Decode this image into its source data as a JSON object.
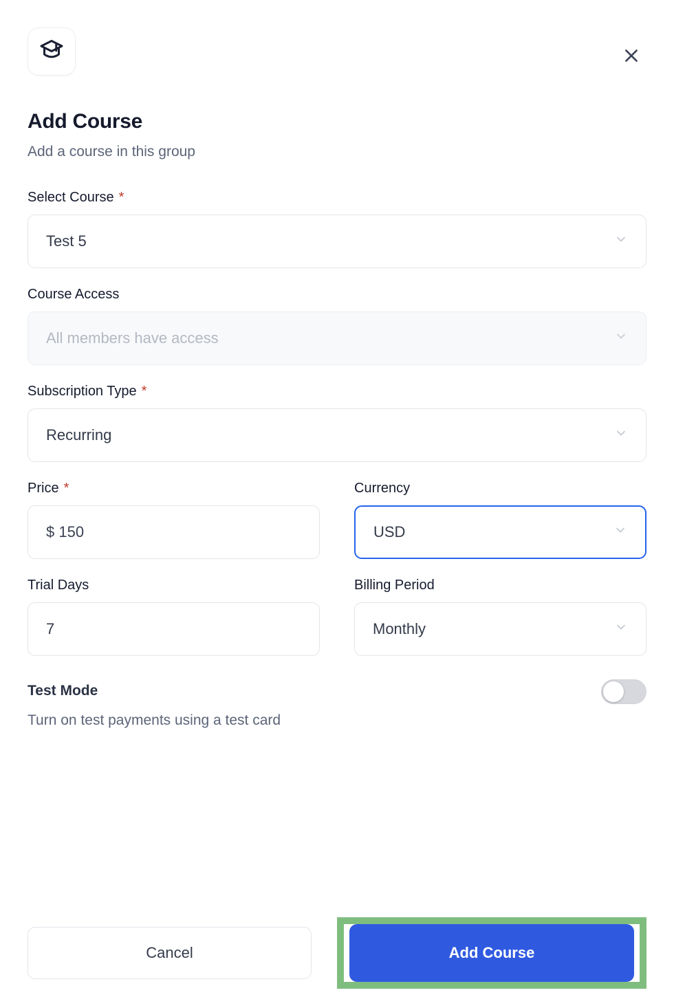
{
  "dialog": {
    "icon": "graduation-cap-icon",
    "close_icon": "close-icon",
    "title": "Add Course",
    "subtitle": "Add a course in this group"
  },
  "fields": {
    "select_course": {
      "label": "Select Course",
      "required_marker": "*",
      "value": "Test 5",
      "chevron": "chevron-down-icon"
    },
    "course_access": {
      "label": "Course Access",
      "placeholder": "All members have access",
      "value": "All members have access",
      "disabled": true,
      "chevron": "chevron-down-icon"
    },
    "subscription_type": {
      "label": "Subscription Type",
      "required_marker": "*",
      "value": "Recurring",
      "chevron": "chevron-down-icon"
    },
    "price": {
      "label": "Price",
      "required_marker": "*",
      "value": "$ 150"
    },
    "currency": {
      "label": "Currency",
      "value": "USD",
      "focused": true,
      "chevron": "chevron-down-icon"
    },
    "trial_days": {
      "label": "Trial Days",
      "value": "7"
    },
    "billing_period": {
      "label": "Billing Period",
      "value": "Monthly",
      "chevron": "chevron-down-icon"
    }
  },
  "test_mode": {
    "label": "Test Mode",
    "description": "Turn on test payments using a test card",
    "enabled": false
  },
  "footer": {
    "cancel_label": "Cancel",
    "submit_label": "Add Course"
  },
  "colors": {
    "primary_button": "#2F5AE0",
    "focus_border": "#2563EB",
    "highlight_box": "#7FBD7F",
    "required_asterisk": "#C0392B",
    "title_text": "#151A2D",
    "muted_text": "#5B6478"
  }
}
